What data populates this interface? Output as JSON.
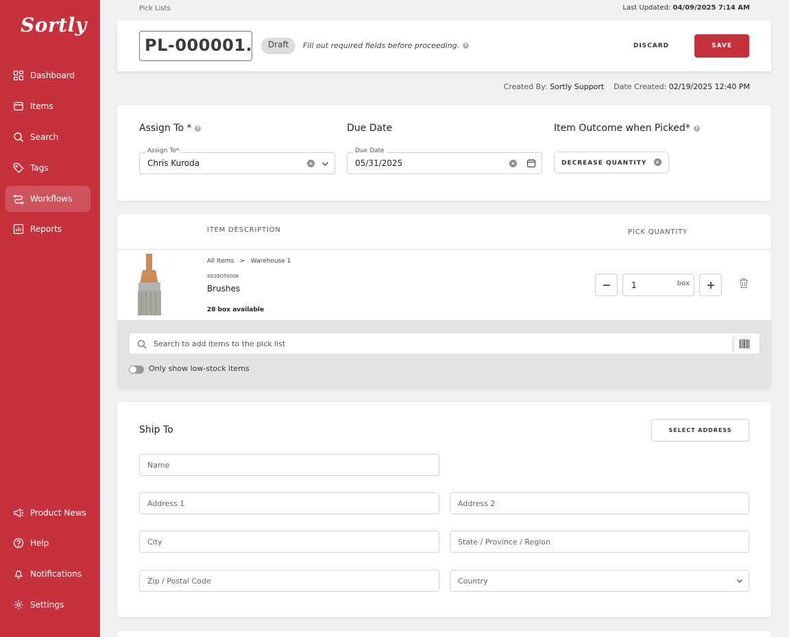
{
  "brand": {
    "logo_text": "Sortly",
    "accent": "#c5313c"
  },
  "sidebar": {
    "items": [
      {
        "label": "Dashboard",
        "icon": "dashboard-icon"
      },
      {
        "label": "Items",
        "icon": "items-icon"
      },
      {
        "label": "Search",
        "icon": "search-icon"
      },
      {
        "label": "Tags",
        "icon": "tag-icon"
      },
      {
        "label": "Workflows",
        "icon": "workflows-icon",
        "active": true
      },
      {
        "label": "Reports",
        "icon": "reports-icon"
      }
    ],
    "bottom_items": [
      {
        "label": "Product News",
        "icon": "megaphone-icon"
      },
      {
        "label": "Help",
        "icon": "help-icon"
      },
      {
        "label": "Notifications",
        "icon": "bell-icon"
      },
      {
        "label": "Settings",
        "icon": "gear-icon"
      }
    ]
  },
  "breadcrumb": "Pick Lists",
  "last_updated": {
    "label": "Last Updated:",
    "value": "04/09/2025 7:14 AM"
  },
  "header": {
    "pick_list_id": "PL-000001.",
    "status_badge": "Draft",
    "hint": "Fill out required fields before proceeding.",
    "discard_label": "DISCARD",
    "save_label": "SAVE"
  },
  "created": {
    "by_label": "Created By:",
    "by_value": "Sortly Support",
    "date_label": "Date Created:",
    "date_value": "02/19/2025 12:40 PM"
  },
  "assign": {
    "assign_title": "Assign To *",
    "assign_label": "Assign To*",
    "assign_value": "Chris Kuroda",
    "due_title": "Due Date",
    "due_label": "Due Date",
    "due_value": "05/31/2025",
    "outcome_title": "Item Outcome when Picked*",
    "outcome_value": "DECREASE QUANTITY"
  },
  "items": {
    "col_description": "ITEM DESCRIPTION",
    "col_quantity": "PICK QUANTITY",
    "rows": [
      {
        "crumb_root": "All Items",
        "crumb_folder": "Warehouse 1",
        "sku": "SG35GT0008",
        "name": "Brushes",
        "available": "28 box available",
        "quantity": "1",
        "unit": "box"
      }
    ],
    "search_placeholder": "Search to add items to the pick list",
    "low_stock_label": "Only show low-stock items"
  },
  "ship_to": {
    "title": "Ship To",
    "select_address_label": "SELECT ADDRESS",
    "fields": {
      "name": "Name",
      "address1": "Address 1",
      "address2": "Address 2",
      "city": "City",
      "state": "State / Province / Region",
      "zip": "Zip / Postal Code",
      "country": "Country"
    }
  }
}
